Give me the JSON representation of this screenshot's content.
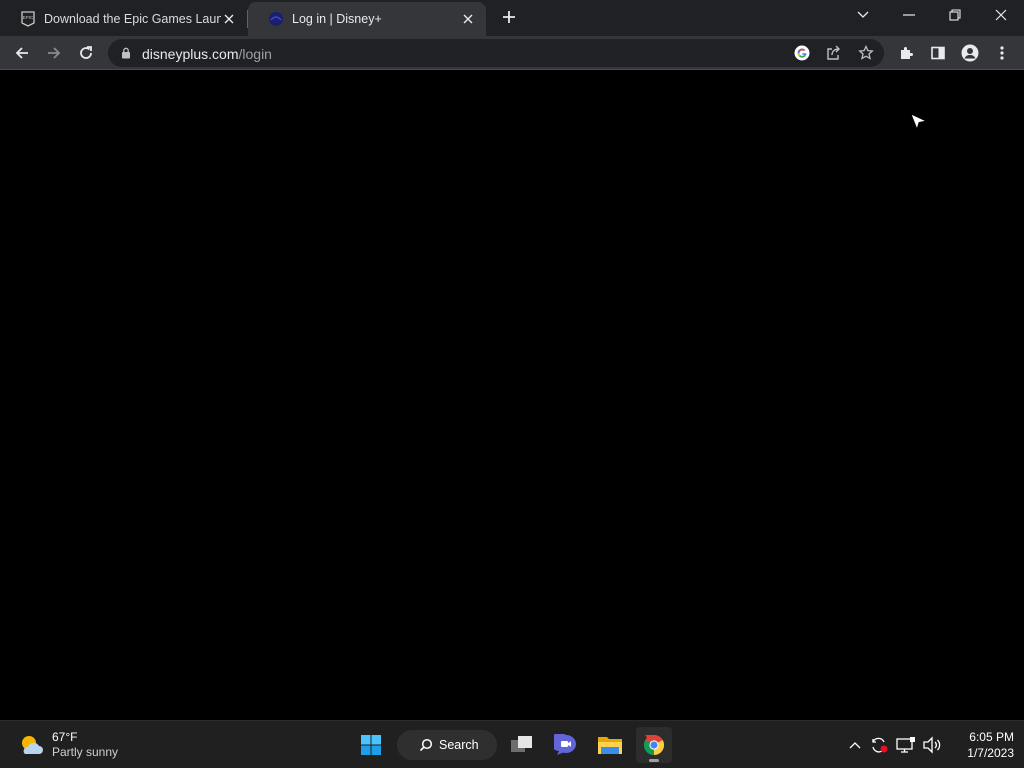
{
  "browser": {
    "tabs": [
      {
        "title": "Download the Epic Games Launcher",
        "favicon": "epic-games-icon",
        "active": false
      },
      {
        "title": "Log in | Disney+",
        "favicon": "disney-plus-icon",
        "active": true
      }
    ],
    "address": {
      "host": "disneyplus.com",
      "path": "/login"
    },
    "accent": "#202124"
  },
  "taskbar": {
    "weather": {
      "temperature": "67°F",
      "condition": "Partly sunny",
      "icon": "partly-sunny-icon"
    },
    "search_label": "Search",
    "apps": [
      "start-icon",
      "task-view-icon",
      "teams-chat-icon",
      "file-explorer-icon",
      "chrome-icon"
    ],
    "clock": {
      "time": "6:05 PM",
      "date": "1/7/2023"
    }
  }
}
